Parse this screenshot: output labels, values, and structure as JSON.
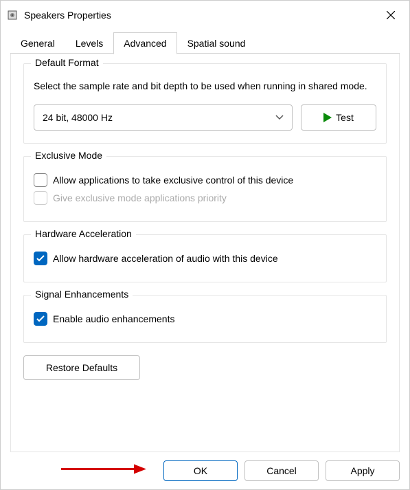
{
  "window": {
    "title": "Speakers Properties"
  },
  "tabs": {
    "general": "General",
    "levels": "Levels",
    "advanced": "Advanced",
    "spatial": "Spatial sound"
  },
  "defaultFormat": {
    "legend": "Default Format",
    "description": "Select the sample rate and bit depth to be used when running in shared mode.",
    "selected": "24 bit, 48000 Hz",
    "testButton": "Test"
  },
  "exclusiveMode": {
    "legend": "Exclusive Mode",
    "allow": "Allow applications to take exclusive control of this device",
    "priority": "Give exclusive mode applications priority"
  },
  "hardwareAccel": {
    "legend": "Hardware Acceleration",
    "allow": "Allow hardware acceleration of audio with this device"
  },
  "signalEnhance": {
    "legend": "Signal Enhancements",
    "enable": "Enable audio enhancements"
  },
  "buttons": {
    "restore": "Restore Defaults",
    "ok": "OK",
    "cancel": "Cancel",
    "apply": "Apply"
  }
}
